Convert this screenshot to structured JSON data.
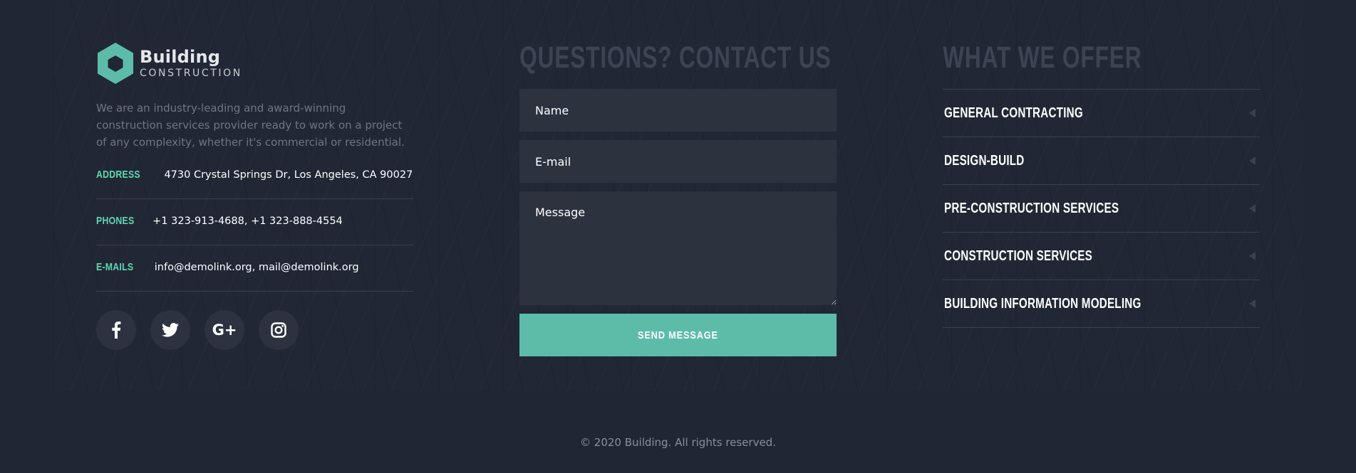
{
  "brand": {
    "name": "Building",
    "subtitle": "CONSTRUCTION",
    "about": "We are an industry-leading and award-winning construction services provider ready to work on a project of any complexity, whether it's commercial or residential."
  },
  "contact_info": [
    {
      "label": "Address",
      "value": "4730 Crystal Springs Dr, Los Angeles, CA 90027"
    },
    {
      "label": "Phones",
      "value": "+1 323-913-4688, +1 323-888-4554"
    },
    {
      "label": "E-mails",
      "value": "info@demolink.org, mail@demolink.org"
    }
  ],
  "socials": [
    {
      "name": "facebook-icon",
      "glyph": "f"
    },
    {
      "name": "twitter-icon",
      "glyph": "twitter"
    },
    {
      "name": "google-plus-icon",
      "glyph": "G+"
    },
    {
      "name": "instagram-icon",
      "glyph": "instagram"
    }
  ],
  "contact_form": {
    "heading": "Questions? Contact us",
    "name_placeholder": "Name",
    "email_placeholder": "E-mail",
    "message_placeholder": "Message",
    "submit_label": "Send message"
  },
  "offer": {
    "heading": "What we offer",
    "items": [
      "General contracting",
      "Design-build",
      "Pre-construction services",
      "Construction services",
      "Building information modeling"
    ]
  },
  "footer": {
    "copyright": "© 2020 Building. All rights reserved."
  },
  "colors": {
    "background": "#212634",
    "accent": "#5dbca8",
    "label_green": "#5fd8b0",
    "field_bg": "#2d323f",
    "heading_muted": "#3c4352"
  }
}
